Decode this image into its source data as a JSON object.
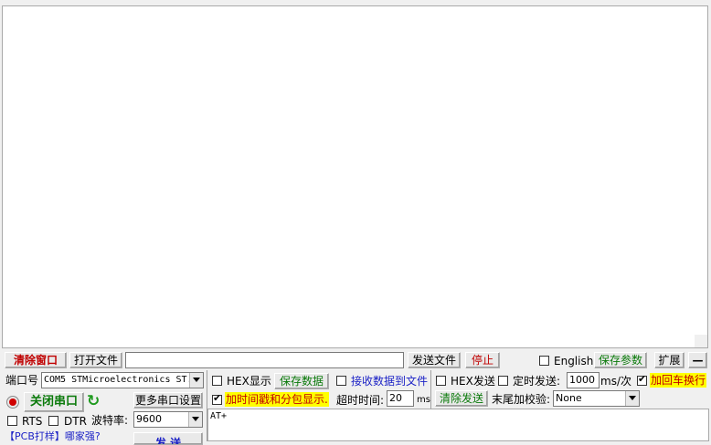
{
  "receive_area": {
    "content": ""
  },
  "toolbar": {
    "clear_window": "清除窗口",
    "open_file": "打开文件",
    "file_path": "",
    "send_file": "发送文件",
    "stop": "停止",
    "english": "English",
    "save_params": "保存参数",
    "expand": "扩展",
    "minimize": "—"
  },
  "port": {
    "port_label": "端口号",
    "port_value": "COM5 STMicroelectronics ST.",
    "close_port": "关闭串口",
    "more_settings": "更多串口设置",
    "rts": "RTS",
    "dtr": "DTR",
    "baud_label": "波特率:",
    "baud_value": "9600",
    "pcb_link": "【PCB打样】",
    "who_link": "哪家强?",
    "send_btn": "发 送"
  },
  "options": {
    "hex_display": "HEX显示",
    "save_data": "保存数据",
    "recv_to_file": "接收数据到文件",
    "hex_send": "HEX发送",
    "timed_send": "定时发送:",
    "interval_value": "1000",
    "interval_unit": "ms/次",
    "add_newline": "加回车换行",
    "timestamp": "加时间戳和分包显示.",
    "timeout_label": "超时时间:",
    "timeout_value": "20",
    "timeout_unit": "ms",
    "clear_send": "清除发送",
    "checksum_label": "末尾加校验:",
    "checksum_value": "None"
  },
  "send_area": {
    "content": "AT+"
  },
  "colors": {
    "highlight": "#ffff00",
    "red_text": "#c00000",
    "green_text": "#0a7a0a"
  }
}
